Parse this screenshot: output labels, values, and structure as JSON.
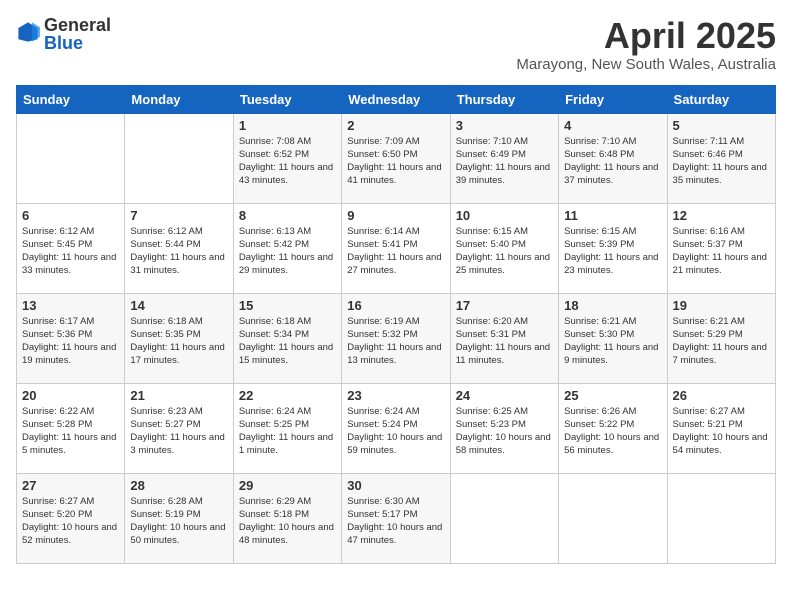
{
  "header": {
    "logo_general": "General",
    "logo_blue": "Blue",
    "month": "April 2025",
    "location": "Marayong, New South Wales, Australia"
  },
  "weekdays": [
    "Sunday",
    "Monday",
    "Tuesday",
    "Wednesday",
    "Thursday",
    "Friday",
    "Saturday"
  ],
  "weeks": [
    [
      {
        "day": "",
        "content": ""
      },
      {
        "day": "",
        "content": ""
      },
      {
        "day": "1",
        "content": "Sunrise: 7:08 AM\nSunset: 6:52 PM\nDaylight: 11 hours and 43 minutes."
      },
      {
        "day": "2",
        "content": "Sunrise: 7:09 AM\nSunset: 6:50 PM\nDaylight: 11 hours and 41 minutes."
      },
      {
        "day": "3",
        "content": "Sunrise: 7:10 AM\nSunset: 6:49 PM\nDaylight: 11 hours and 39 minutes."
      },
      {
        "day": "4",
        "content": "Sunrise: 7:10 AM\nSunset: 6:48 PM\nDaylight: 11 hours and 37 minutes."
      },
      {
        "day": "5",
        "content": "Sunrise: 7:11 AM\nSunset: 6:46 PM\nDaylight: 11 hours and 35 minutes."
      }
    ],
    [
      {
        "day": "6",
        "content": "Sunrise: 6:12 AM\nSunset: 5:45 PM\nDaylight: 11 hours and 33 minutes."
      },
      {
        "day": "7",
        "content": "Sunrise: 6:12 AM\nSunset: 5:44 PM\nDaylight: 11 hours and 31 minutes."
      },
      {
        "day": "8",
        "content": "Sunrise: 6:13 AM\nSunset: 5:42 PM\nDaylight: 11 hours and 29 minutes."
      },
      {
        "day": "9",
        "content": "Sunrise: 6:14 AM\nSunset: 5:41 PM\nDaylight: 11 hours and 27 minutes."
      },
      {
        "day": "10",
        "content": "Sunrise: 6:15 AM\nSunset: 5:40 PM\nDaylight: 11 hours and 25 minutes."
      },
      {
        "day": "11",
        "content": "Sunrise: 6:15 AM\nSunset: 5:39 PM\nDaylight: 11 hours and 23 minutes."
      },
      {
        "day": "12",
        "content": "Sunrise: 6:16 AM\nSunset: 5:37 PM\nDaylight: 11 hours and 21 minutes."
      }
    ],
    [
      {
        "day": "13",
        "content": "Sunrise: 6:17 AM\nSunset: 5:36 PM\nDaylight: 11 hours and 19 minutes."
      },
      {
        "day": "14",
        "content": "Sunrise: 6:18 AM\nSunset: 5:35 PM\nDaylight: 11 hours and 17 minutes."
      },
      {
        "day": "15",
        "content": "Sunrise: 6:18 AM\nSunset: 5:34 PM\nDaylight: 11 hours and 15 minutes."
      },
      {
        "day": "16",
        "content": "Sunrise: 6:19 AM\nSunset: 5:32 PM\nDaylight: 11 hours and 13 minutes."
      },
      {
        "day": "17",
        "content": "Sunrise: 6:20 AM\nSunset: 5:31 PM\nDaylight: 11 hours and 11 minutes."
      },
      {
        "day": "18",
        "content": "Sunrise: 6:21 AM\nSunset: 5:30 PM\nDaylight: 11 hours and 9 minutes."
      },
      {
        "day": "19",
        "content": "Sunrise: 6:21 AM\nSunset: 5:29 PM\nDaylight: 11 hours and 7 minutes."
      }
    ],
    [
      {
        "day": "20",
        "content": "Sunrise: 6:22 AM\nSunset: 5:28 PM\nDaylight: 11 hours and 5 minutes."
      },
      {
        "day": "21",
        "content": "Sunrise: 6:23 AM\nSunset: 5:27 PM\nDaylight: 11 hours and 3 minutes."
      },
      {
        "day": "22",
        "content": "Sunrise: 6:24 AM\nSunset: 5:25 PM\nDaylight: 11 hours and 1 minute."
      },
      {
        "day": "23",
        "content": "Sunrise: 6:24 AM\nSunset: 5:24 PM\nDaylight: 10 hours and 59 minutes."
      },
      {
        "day": "24",
        "content": "Sunrise: 6:25 AM\nSunset: 5:23 PM\nDaylight: 10 hours and 58 minutes."
      },
      {
        "day": "25",
        "content": "Sunrise: 6:26 AM\nSunset: 5:22 PM\nDaylight: 10 hours and 56 minutes."
      },
      {
        "day": "26",
        "content": "Sunrise: 6:27 AM\nSunset: 5:21 PM\nDaylight: 10 hours and 54 minutes."
      }
    ],
    [
      {
        "day": "27",
        "content": "Sunrise: 6:27 AM\nSunset: 5:20 PM\nDaylight: 10 hours and 52 minutes."
      },
      {
        "day": "28",
        "content": "Sunrise: 6:28 AM\nSunset: 5:19 PM\nDaylight: 10 hours and 50 minutes."
      },
      {
        "day": "29",
        "content": "Sunrise: 6:29 AM\nSunset: 5:18 PM\nDaylight: 10 hours and 48 minutes."
      },
      {
        "day": "30",
        "content": "Sunrise: 6:30 AM\nSunset: 5:17 PM\nDaylight: 10 hours and 47 minutes."
      },
      {
        "day": "",
        "content": ""
      },
      {
        "day": "",
        "content": ""
      },
      {
        "day": "",
        "content": ""
      }
    ]
  ]
}
